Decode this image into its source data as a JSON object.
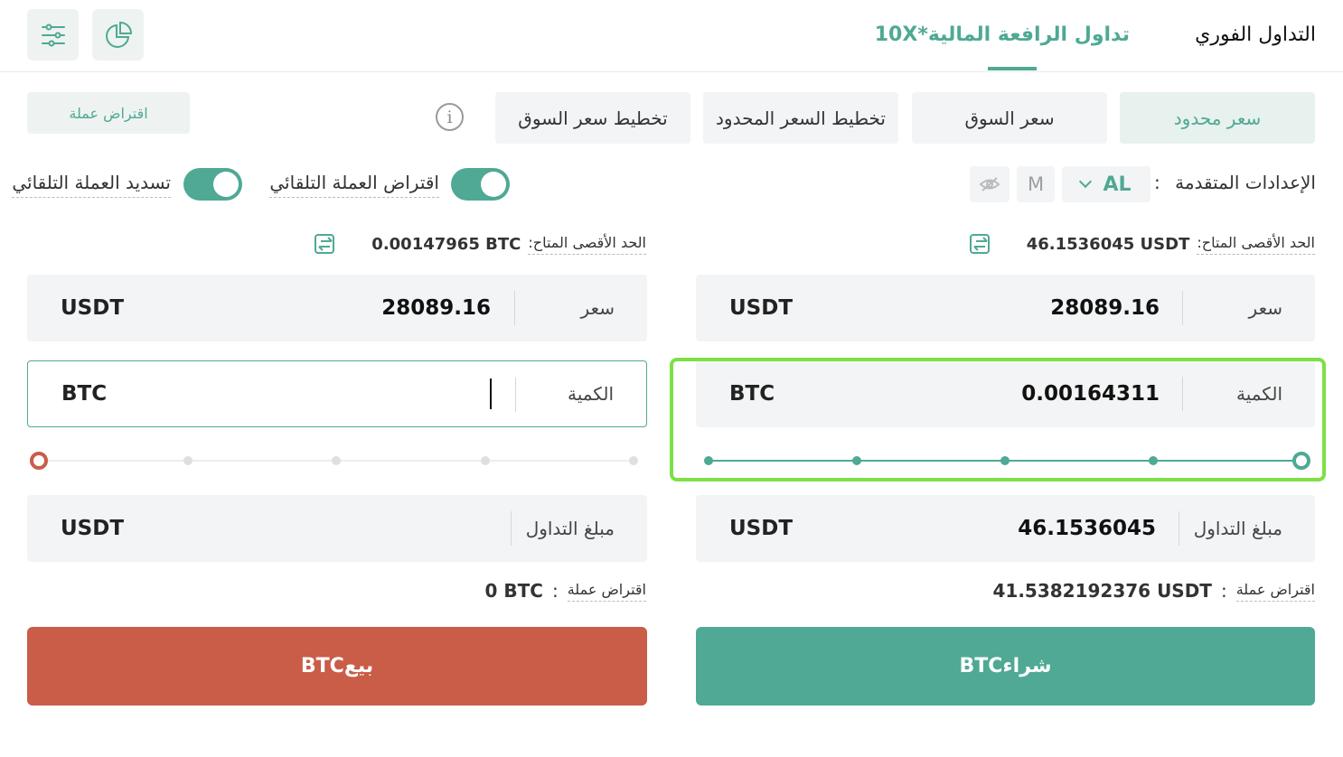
{
  "header": {
    "tab_spot": "التداول الفوري",
    "tab_margin": "تداول الرافعة المالية*10X",
    "filter_icon": "sliders-icon",
    "chart_icon": "pie-chart-icon"
  },
  "order_types": {
    "limit": "سعر محدود",
    "market": "سعر السوق",
    "limit_plan": "تخطيط السعر المحدود",
    "market_plan": "تخطيط سعر السوق",
    "borrow_button": "اقتراض عملة"
  },
  "settings": {
    "label": "الإعدادات المتقدمة",
    "colon": ":",
    "mode": "AL",
    "m": "M",
    "auto_borrow": "اقتراض العملة التلقائي",
    "auto_repay": "تسديد العملة التلقائي"
  },
  "buy": {
    "max_label": "الحد الأقصى المتاح:",
    "max_value": "46.1536045",
    "max_unit": "USDT",
    "price_label": "سعر",
    "price_value": "28089.16",
    "price_unit": "USDT",
    "qty_label": "الكمية",
    "qty_value": "0.00164311",
    "qty_unit": "BTC",
    "slider_percent": 100,
    "amount_label": "مبلغ التداول",
    "amount_value": "46.1536045",
    "amount_unit": "USDT",
    "borrow_label": "اقتراض عملة",
    "borrow_colon": ":",
    "borrow_value": "41.5382192376",
    "borrow_unit": "USDT",
    "button": "شراءBTC"
  },
  "sell": {
    "max_label": "الحد الأقصى المتاح:",
    "max_value": "0.00147965",
    "max_unit": "BTC",
    "price_label": "سعر",
    "price_value": "28089.16",
    "price_unit": "USDT",
    "qty_label": "الكمية",
    "qty_value": "",
    "qty_unit": "BTC",
    "slider_percent": 0,
    "amount_label": "مبلغ التداول",
    "amount_value": "",
    "amount_unit": "USDT",
    "borrow_label": "اقتراض عملة",
    "borrow_colon": ":",
    "borrow_value": "0",
    "borrow_unit": "BTC",
    "button": "بيعBTC"
  },
  "colors": {
    "accent": "#4fa994",
    "sell": "#c95d48",
    "highlight": "#7de044"
  }
}
